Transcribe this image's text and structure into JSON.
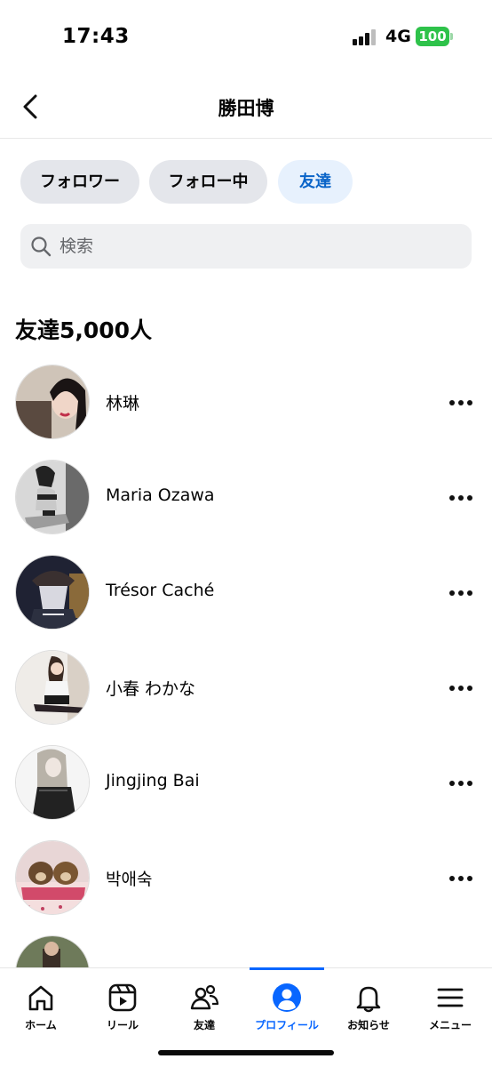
{
  "status_bar": {
    "time": "17:43",
    "network": "4G",
    "battery": "100"
  },
  "header": {
    "title": "勝田博",
    "back_icon": "chevron-left-icon"
  },
  "tabs": [
    {
      "label": "フォロワー",
      "active": false
    },
    {
      "label": "フォロー中",
      "active": false
    },
    {
      "label": "友達",
      "active": true
    }
  ],
  "search": {
    "placeholder": "検索",
    "value": "",
    "icon": "search-icon"
  },
  "section_title": "友達5,000人",
  "friends": [
    {
      "name": "林琳"
    },
    {
      "name": "Maria Ozawa"
    },
    {
      "name": "Trésor Caché"
    },
    {
      "name": "小春 わかな"
    },
    {
      "name": "Jingjing Bai"
    },
    {
      "name": "박애숙"
    },
    {
      "name": ""
    }
  ],
  "bottom_nav": [
    {
      "label": "ホーム",
      "icon": "home-icon",
      "active": false
    },
    {
      "label": "リール",
      "icon": "reels-icon",
      "active": false
    },
    {
      "label": "友達",
      "icon": "friends-icon",
      "active": false
    },
    {
      "label": "プロフィール",
      "icon": "profile-icon",
      "active": true
    },
    {
      "label": "お知らせ",
      "icon": "bell-icon",
      "active": false
    },
    {
      "label": "メニュー",
      "icon": "menu-icon",
      "active": false
    }
  ],
  "colors": {
    "accent": "#0866ff",
    "active_chip_bg": "#e7f1fd",
    "chip_bg": "#e4e6eb",
    "battery": "#2ec24a"
  }
}
